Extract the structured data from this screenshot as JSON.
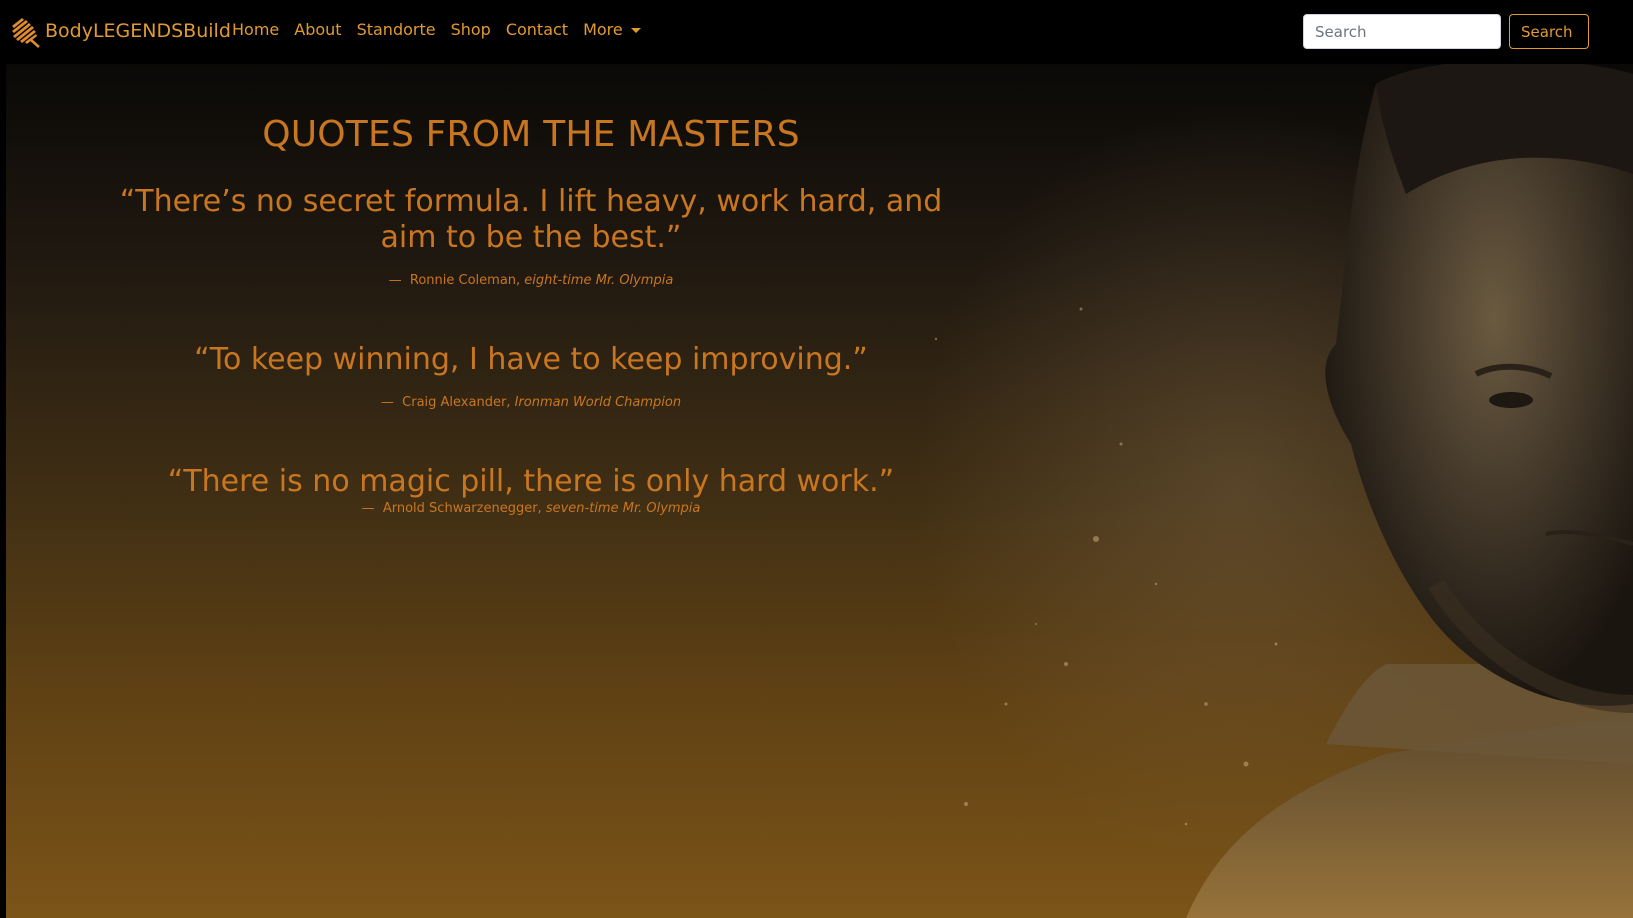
{
  "nav": {
    "brand": "BodyLEGENDSBuild",
    "links": [
      "Home",
      "About",
      "Standorte",
      "Shop",
      "Contact"
    ],
    "more_label": "More",
    "search_placeholder": "Search",
    "search_button": "Search"
  },
  "hero": {
    "title": "QUOTES FROM THE MASTERS",
    "quotes": [
      {
        "text": "“There’s no secret formula. I lift heavy, work hard, and aim to be the best.”",
        "author": "Ronnie Coleman,",
        "role": "eight-time Mr. Olympia"
      },
      {
        "text": "“To keep winning, I have to keep improving.”",
        "author": "Craig Alexander,",
        "role": "Ironman World Champion"
      },
      {
        "text": "“There is no magic pill, there is only hard work.”",
        "author": "Arnold Schwarzenegger,",
        "role": "seven-time Mr. Olympia"
      }
    ],
    "dash": "—"
  },
  "colors": {
    "accent": "#e09a32",
    "quote": "#c97621",
    "nav_bg": "#000000"
  }
}
